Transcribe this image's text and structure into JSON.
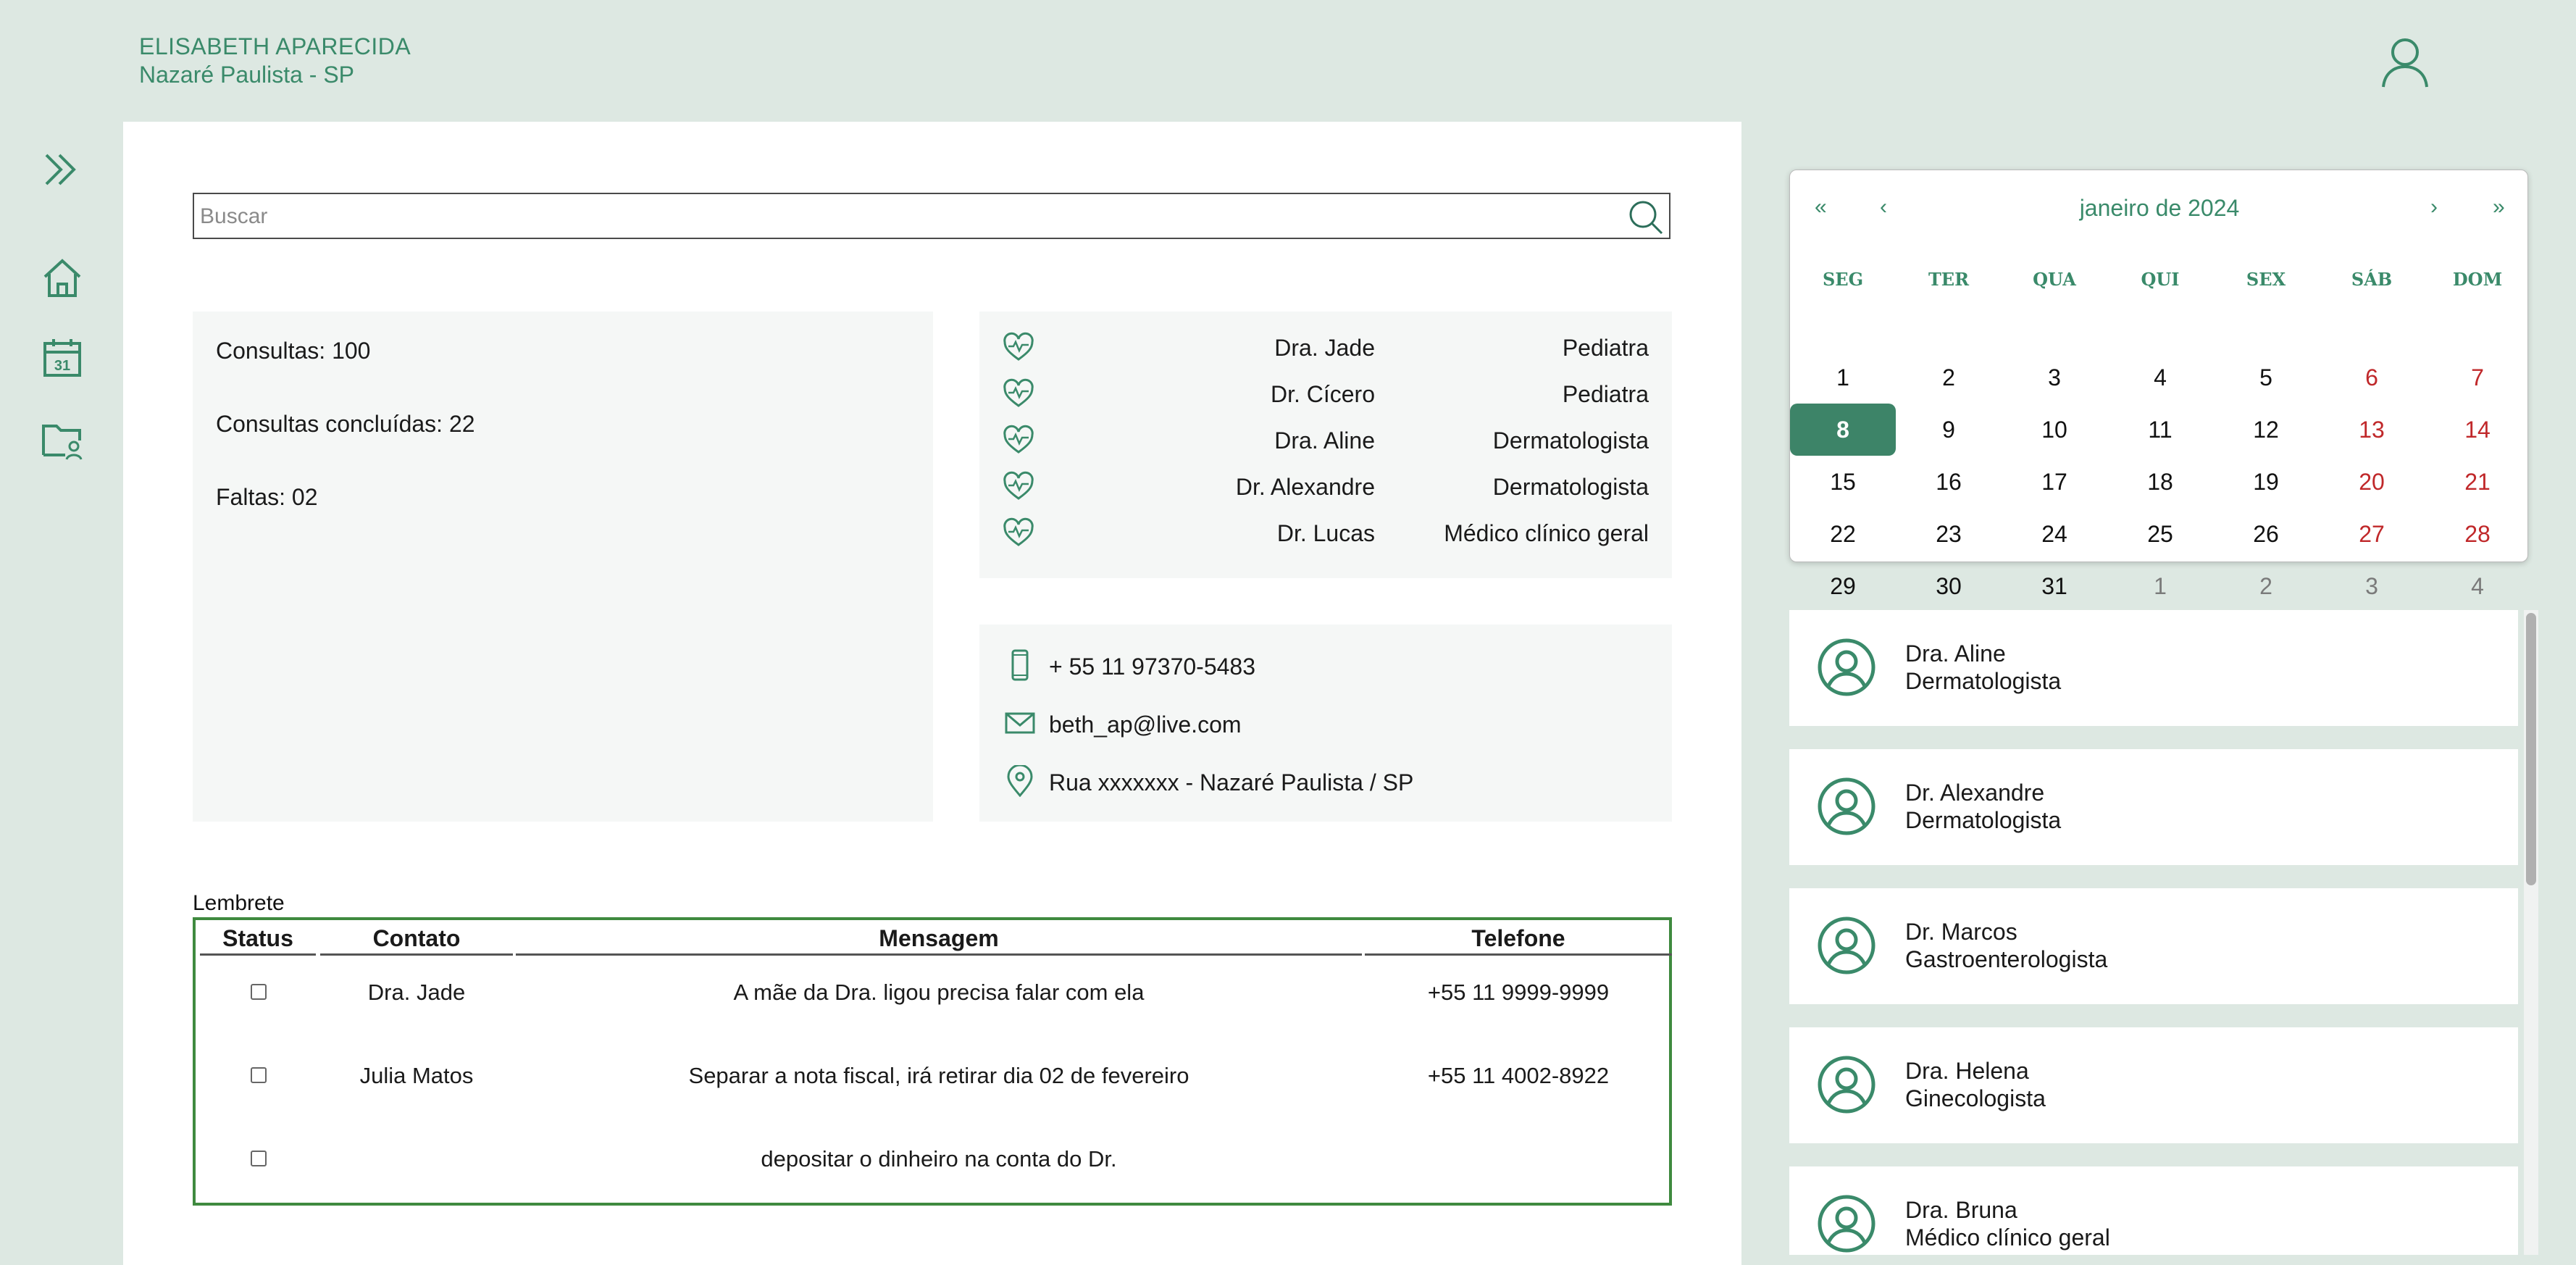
{
  "header": {
    "user_name": "ELISABETH APARECIDA",
    "user_city": "Nazaré Paulista - SP"
  },
  "sidebar": {
    "icons": [
      "double-chevron-right-icon",
      "home-icon",
      "calendar-icon",
      "folder-user-icon"
    ],
    "calendar_icon_day": "31"
  },
  "search": {
    "placeholder": "Buscar"
  },
  "stats": {
    "consultas": "Consultas: 100",
    "concluidas": "Consultas concluídas: 22",
    "faltas": "Faltas: 02"
  },
  "doctors": [
    {
      "name": "Dra. Jade",
      "specialty": "Pediatra"
    },
    {
      "name": "Dr. Cícero",
      "specialty": "Pediatra"
    },
    {
      "name": "Dra. Aline",
      "specialty": "Dermatologista"
    },
    {
      "name": "Dr. Alexandre",
      "specialty": "Dermatologista"
    },
    {
      "name": "Dr. Lucas",
      "specialty": "Médico clínico geral"
    }
  ],
  "contact": {
    "phone": "+ 55 11 97370-5483",
    "email": "beth_ap@live.com",
    "address": "Rua xxxxxxx - Nazaré Paulista / SP"
  },
  "reminder": {
    "label": "Lembrete",
    "headers": {
      "status": "Status",
      "contato": "Contato",
      "mensagem": "Mensagem",
      "telefone": "Telefone"
    },
    "rows": [
      {
        "contato": "Dra. Jade",
        "mensagem": "A mãe da Dra. ligou precisa falar com ela",
        "telefone": "+55 11 9999-9999",
        "checked": false
      },
      {
        "contato": "Julia Matos",
        "mensagem": "Separar a nota fiscal, irá retirar dia 02 de fevereiro",
        "telefone": "+55 11 4002-8922",
        "checked": false
      },
      {
        "contato": "",
        "mensagem": "depositar o dinheiro na conta do Dr.",
        "telefone": "",
        "checked": false
      }
    ]
  },
  "calendar": {
    "title": "janeiro de 2024",
    "nav": {
      "prev_year": "«",
      "prev_month": "‹",
      "next_month": "›",
      "next_year": "»"
    },
    "weekdays": [
      "SEG",
      "TER",
      "QUA",
      "QUI",
      "SEX",
      "SÁB",
      "DOM"
    ],
    "weeks": [
      [
        "1",
        "2",
        "3",
        "4",
        "5",
        "6",
        "7"
      ],
      [
        "8",
        "9",
        "10",
        "11",
        "12",
        "13",
        "14"
      ],
      [
        "15",
        "16",
        "17",
        "18",
        "19",
        "20",
        "21"
      ],
      [
        "22",
        "23",
        "24",
        "25",
        "26",
        "27",
        "28"
      ],
      [
        "29",
        "30",
        "31",
        "1",
        "2",
        "3",
        "4"
      ]
    ],
    "selected_day": "8",
    "colors": {
      "accent": "#3d8468",
      "weekend": "#c0282a",
      "other_month": "#7a7a7a"
    }
  },
  "doctor_list": [
    {
      "name": "Dra. Aline",
      "specialty": "Dermatologista"
    },
    {
      "name": "Dr. Alexandre",
      "specialty": "Dermatologista"
    },
    {
      "name": "Dr. Marcos",
      "specialty": "Gastroenterologista"
    },
    {
      "name": "Dra. Helena",
      "specialty": "Ginecologista"
    },
    {
      "name": "Dra. Bruna",
      "specialty": "Médico clínico geral"
    }
  ],
  "colors": {
    "primary": "#3a8a6a",
    "background": "#dde8e2",
    "panel": "#f5f7f6",
    "reminder_border": "#3f8a3f"
  }
}
